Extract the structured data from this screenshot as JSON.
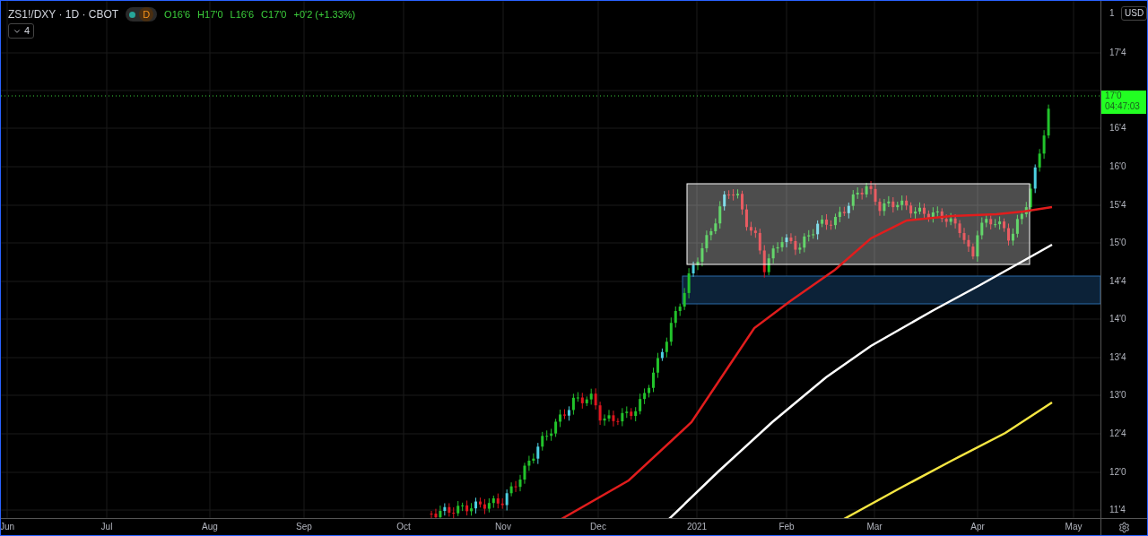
{
  "symbol": {
    "title": "ZS1!/DXY · 1D · CBOT",
    "status_badge": "D",
    "ohlc": [
      "O16'6",
      "H17'0",
      "L16'6",
      "C17'0",
      "+0'2 (+1.33%)"
    ]
  },
  "indicators_toggle": {
    "label": "4"
  },
  "price_axis": {
    "currency": "USD",
    "labels": [
      "1",
      "17'4",
      "16'4",
      "16'0",
      "15'4",
      "15'0",
      "14'4",
      "14'0",
      "13'4",
      "13'0",
      "12'4",
      "12'0",
      "11'4"
    ],
    "current_price": {
      "price": "17'0",
      "countdown": "04:47:03"
    }
  },
  "time_axis": {
    "labels": [
      "Jun",
      "Jul",
      "Aug",
      "Sep",
      "Oct",
      "Nov",
      "Dec",
      "2021",
      "Feb",
      "Mar",
      "Apr",
      "May"
    ]
  }
}
